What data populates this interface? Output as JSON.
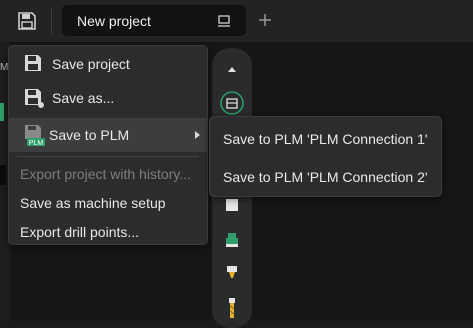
{
  "header": {
    "tab_title": "New project",
    "icons": {
      "save": "save-icon",
      "tab": "monitor-icon",
      "add": "plus-icon"
    }
  },
  "left_panel": {
    "label": "Ma"
  },
  "menu": {
    "items": [
      {
        "label": "Save project",
        "icon": "save-icon"
      },
      {
        "label": "Save as...",
        "icon": "save-as-icon"
      },
      {
        "label": "Save to PLM",
        "icon": "plm-save-icon"
      },
      {
        "label": "Export project with history..."
      },
      {
        "label": "Save as machine setup"
      },
      {
        "label": "Export drill points..."
      }
    ]
  },
  "submenu": {
    "items": [
      {
        "label": "Save to PLM 'PLM Connection 1'"
      },
      {
        "label": "Save to PLM 'PLM Connection 2'"
      }
    ]
  },
  "toolbar": {
    "icons": [
      "chevron-up-icon",
      "machine-icon",
      "square-icon",
      "tool-holder-icon",
      "drill-bit-icon",
      "end-mill-icon"
    ]
  },
  "colors": {
    "accent": "#2fa06b",
    "menu_bg": "#2b2c2d",
    "highlight": "#3c3d3e"
  }
}
